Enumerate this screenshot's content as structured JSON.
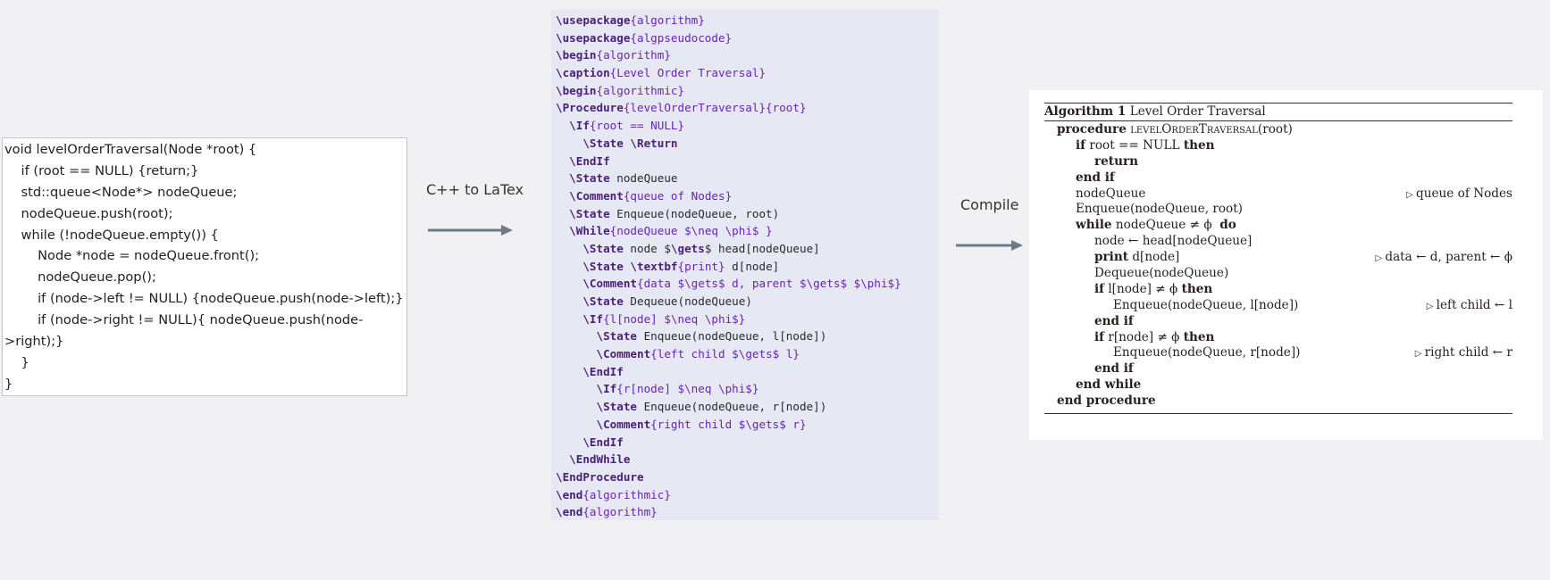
{
  "cpp_code": {
    "lines": [
      "void levelOrderTraversal(Node *root) {",
      "    if (root == NULL) {return;}",
      "    std::queue<Node*> nodeQueue;",
      "    nodeQueue.push(root);",
      "    while (!nodeQueue.empty()) {",
      "        Node *node = nodeQueue.front();",
      "        nodeQueue.pop();",
      "        if (node->left != NULL) {nodeQueue.push(node->left);}",
      "        if (node->right != NULL){ nodeQueue.push(node-",
      ">right);}",
      "    }",
      "}"
    ]
  },
  "arrows": {
    "cpp_to_latex_label": "C++ to LaTex",
    "compile_label": "Compile",
    "arrow_color": "#6c7a8a"
  },
  "latex_source": {
    "lines": [
      {
        "indent": "",
        "cmd": "\\usepackage",
        "arg": "{algorithm}"
      },
      {
        "indent": "",
        "cmd": "\\usepackage",
        "arg": "{algpseudocode}"
      },
      {
        "indent": "",
        "cmd": "\\begin",
        "arg": "{algorithm}"
      },
      {
        "indent": "",
        "cmd": "\\caption",
        "arg": "{Level Order Traversal}"
      },
      {
        "indent": "",
        "cmd": "\\begin",
        "arg": "{algorithmic}"
      },
      {
        "indent": "",
        "cmd": "\\Procedure",
        "arg": "{levelOrderTraversal}{root}"
      },
      {
        "indent": "  ",
        "cmd": "\\If",
        "arg": "{root == NULL}"
      },
      {
        "indent": "    ",
        "cmd": "\\State \\Return",
        "arg": ""
      },
      {
        "indent": "  ",
        "cmd": "\\EndIf",
        "arg": ""
      },
      {
        "indent": "  ",
        "cmd": "\\State",
        "text": " nodeQueue"
      },
      {
        "indent": "  ",
        "cmd": "\\Comment",
        "arg": "{queue of Nodes}"
      },
      {
        "indent": "  ",
        "cmd": "\\State",
        "text": " Enqueue(nodeQueue, root)"
      },
      {
        "indent": "  ",
        "cmd": "\\While",
        "arg": "{nodeQueue $\\neq \\phi$ }"
      },
      {
        "indent": "    ",
        "cmd": "\\State",
        "text": " node $",
        "cmd2": "\\gets",
        "text2": "$ head[nodeQueue]"
      },
      {
        "indent": "    ",
        "cmd": "\\State \\textbf",
        "arg": "{print}",
        "text": " d[node]"
      },
      {
        "indent": "    ",
        "cmd": "\\Comment",
        "arg": "{data $\\gets$ d, parent $\\gets$ $\\phi$}"
      },
      {
        "indent": "    ",
        "cmd": "\\State",
        "text": " Dequeue(nodeQueue)"
      },
      {
        "indent": "    ",
        "cmd": "\\If",
        "arg": "{l[node] $\\neq \\phi$}"
      },
      {
        "indent": "      ",
        "cmd": "\\State",
        "text": " Enqueue(nodeQueue, l[node])"
      },
      {
        "indent": "      ",
        "cmd": "\\Comment",
        "arg": "{left child $\\gets$ l}"
      },
      {
        "indent": "    ",
        "cmd": "\\EndIf",
        "arg": ""
      },
      {
        "indent": "      ",
        "cmd": "\\If",
        "arg": "{r[node] $\\neq \\phi$}"
      },
      {
        "indent": "      ",
        "cmd": "\\State",
        "text": " Enqueue(nodeQueue, r[node])"
      },
      {
        "indent": "      ",
        "cmd": "\\Comment",
        "arg": "{right child $\\gets$ r}"
      },
      {
        "indent": "    ",
        "cmd": "\\EndIf",
        "arg": ""
      },
      {
        "indent": "  ",
        "cmd": "\\EndWhile",
        "arg": ""
      },
      {
        "indent": "",
        "cmd": "\\EndProcedure",
        "arg": ""
      },
      {
        "indent": "",
        "cmd": "\\end",
        "arg": "{algorithmic}"
      },
      {
        "indent": "",
        "cmd": "\\end",
        "arg": "{algorithm}"
      }
    ]
  },
  "compiled_algorithm": {
    "caption_label": "Algorithm 1",
    "caption_title": "Level Order Traversal",
    "lines": [
      {
        "indent": 0,
        "parts": [
          {
            "t": "procedure",
            "s": "b"
          },
          {
            "t": " "
          },
          {
            "t": "levelOrderTraversal",
            "s": "sc"
          },
          {
            "t": "(root)"
          }
        ]
      },
      {
        "indent": 1,
        "parts": [
          {
            "t": "if",
            "s": "b"
          },
          {
            "t": " root == NULL "
          },
          {
            "t": "then",
            "s": "b"
          }
        ]
      },
      {
        "indent": 2,
        "parts": [
          {
            "t": "return",
            "s": "b"
          }
        ]
      },
      {
        "indent": 1,
        "parts": [
          {
            "t": "end if",
            "s": "b"
          }
        ]
      },
      {
        "indent": 1,
        "parts": [
          {
            "t": "nodeQueue"
          }
        ],
        "comment": "queue of Nodes"
      },
      {
        "indent": 1,
        "parts": [
          {
            "t": "Enqueue(nodeQueue, root)"
          }
        ]
      },
      {
        "indent": 1,
        "parts": [
          {
            "t": "while",
            "s": "b"
          },
          {
            "t": " nodeQueue ≠ ϕ  "
          },
          {
            "t": "do",
            "s": "b"
          }
        ]
      },
      {
        "indent": 2,
        "parts": [
          {
            "t": "node ← head[nodeQueue]"
          }
        ]
      },
      {
        "indent": 2,
        "parts": [
          {
            "t": "print",
            "s": "b"
          },
          {
            "t": " d[node]"
          }
        ],
        "comment": "data ← d, parent ← ϕ"
      },
      {
        "indent": 2,
        "parts": [
          {
            "t": "Dequeue(nodeQueue)"
          }
        ]
      },
      {
        "indent": 2,
        "parts": [
          {
            "t": "if",
            "s": "b"
          },
          {
            "t": " l[node] ≠ ϕ "
          },
          {
            "t": "then",
            "s": "b"
          }
        ]
      },
      {
        "indent": 3,
        "parts": [
          {
            "t": "Enqueue(nodeQueue, l[node])"
          }
        ],
        "comment": "left child ← l"
      },
      {
        "indent": 2,
        "parts": [
          {
            "t": "end if",
            "s": "b"
          }
        ]
      },
      {
        "indent": 2,
        "parts": [
          {
            "t": "if",
            "s": "b"
          },
          {
            "t": " r[node] ≠ ϕ "
          },
          {
            "t": "then",
            "s": "b"
          }
        ]
      },
      {
        "indent": 3,
        "parts": [
          {
            "t": "Enqueue(nodeQueue, r[node])"
          }
        ],
        "comment": "right child ← r"
      },
      {
        "indent": 2,
        "parts": [
          {
            "t": "end if",
            "s": "b"
          }
        ]
      },
      {
        "indent": 1,
        "parts": [
          {
            "t": "end while",
            "s": "b"
          }
        ]
      },
      {
        "indent": 0,
        "parts": [
          {
            "t": "end procedure",
            "s": "b"
          }
        ]
      }
    ]
  }
}
